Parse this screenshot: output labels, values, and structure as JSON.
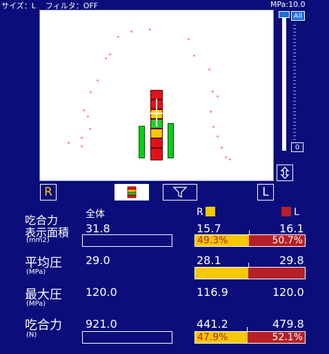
{
  "status": {
    "size_label": "サイズ：L",
    "filter_label": "フィルタ：OFF",
    "mpa_label": "MPa:10.0"
  },
  "slider": {
    "top_label": "All",
    "bottom_label": "0"
  },
  "toolbar": {
    "r_button": "R",
    "l_button": "L"
  },
  "summary": {
    "col_all": "全体",
    "col_r": "R",
    "col_l": "L",
    "colors": {
      "r": "#f5c800",
      "l": "#b62026"
    },
    "rows": [
      {
        "label": "吃合力",
        "label2": "表示面積",
        "unit": "(mm2)",
        "all": "31.8",
        "r": "15.7",
        "l": "16.1",
        "r_pct": "49.3%",
        "l_pct": "50.7%",
        "r_frac": 0.493
      },
      {
        "label": "平均圧",
        "unit": "(MPa)",
        "all": "29.0",
        "r": "28.1",
        "l": "29.8",
        "r_frac": 0.485
      },
      {
        "label": "最大圧",
        "unit": "(MPa)",
        "all": "120.0",
        "r": "116.9",
        "l": "120.0"
      },
      {
        "label": "吃合力",
        "unit": "(N)",
        "all": "921.0",
        "r": "441.2",
        "l": "479.8",
        "r_pct": "47.9%",
        "l_pct": "52.1%",
        "r_frac": 0.479
      }
    ]
  }
}
